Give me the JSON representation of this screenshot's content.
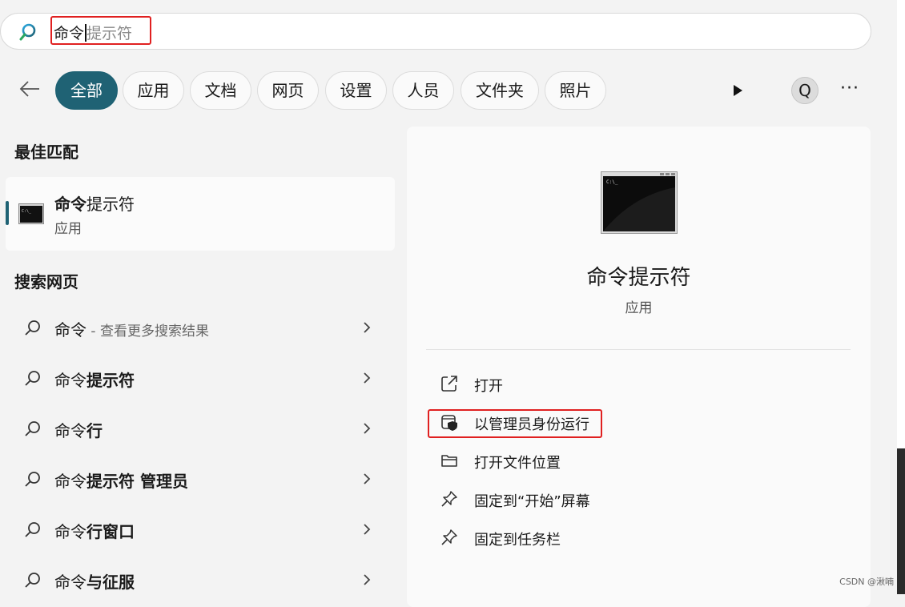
{
  "search": {
    "typed": "命令",
    "hint": "提示符"
  },
  "filters": [
    "全部",
    "应用",
    "文档",
    "网页",
    "设置",
    "人员",
    "文件夹",
    "照片"
  ],
  "profile_initial": "Q",
  "more_label": "···",
  "sections": {
    "best_match": "最佳匹配",
    "search_web": "搜索网页"
  },
  "best_match": {
    "title_bold": "命令",
    "title_rest": "提示符",
    "subtitle": "应用"
  },
  "web_results": [
    {
      "plain": "命令",
      "bold": "",
      "muted": " - 查看更多搜索结果"
    },
    {
      "plain": "命令",
      "bold": "提示符",
      "muted": ""
    },
    {
      "plain": "命令",
      "bold": "行",
      "muted": ""
    },
    {
      "plain": "命令",
      "bold": "提示符 管理员",
      "muted": ""
    },
    {
      "plain": "命令",
      "bold": "行窗口",
      "muted": ""
    },
    {
      "plain": "命令",
      "bold": "与征服",
      "muted": ""
    }
  ],
  "detail": {
    "title": "命令提示符",
    "subtitle": "应用",
    "actions": [
      {
        "icon": "open-external-icon",
        "label": "打开"
      },
      {
        "icon": "shield-icon",
        "label": "以管理员身份运行"
      },
      {
        "icon": "folder-icon",
        "label": "打开文件位置"
      },
      {
        "icon": "pin-icon",
        "label": "固定到“开始”屏幕"
      },
      {
        "icon": "pin-icon",
        "label": "固定到任务栏"
      }
    ]
  },
  "watermark": "CSDN @湫喃",
  "colors": {
    "accent": "#1f6274",
    "highlight_box": "#e02020"
  }
}
